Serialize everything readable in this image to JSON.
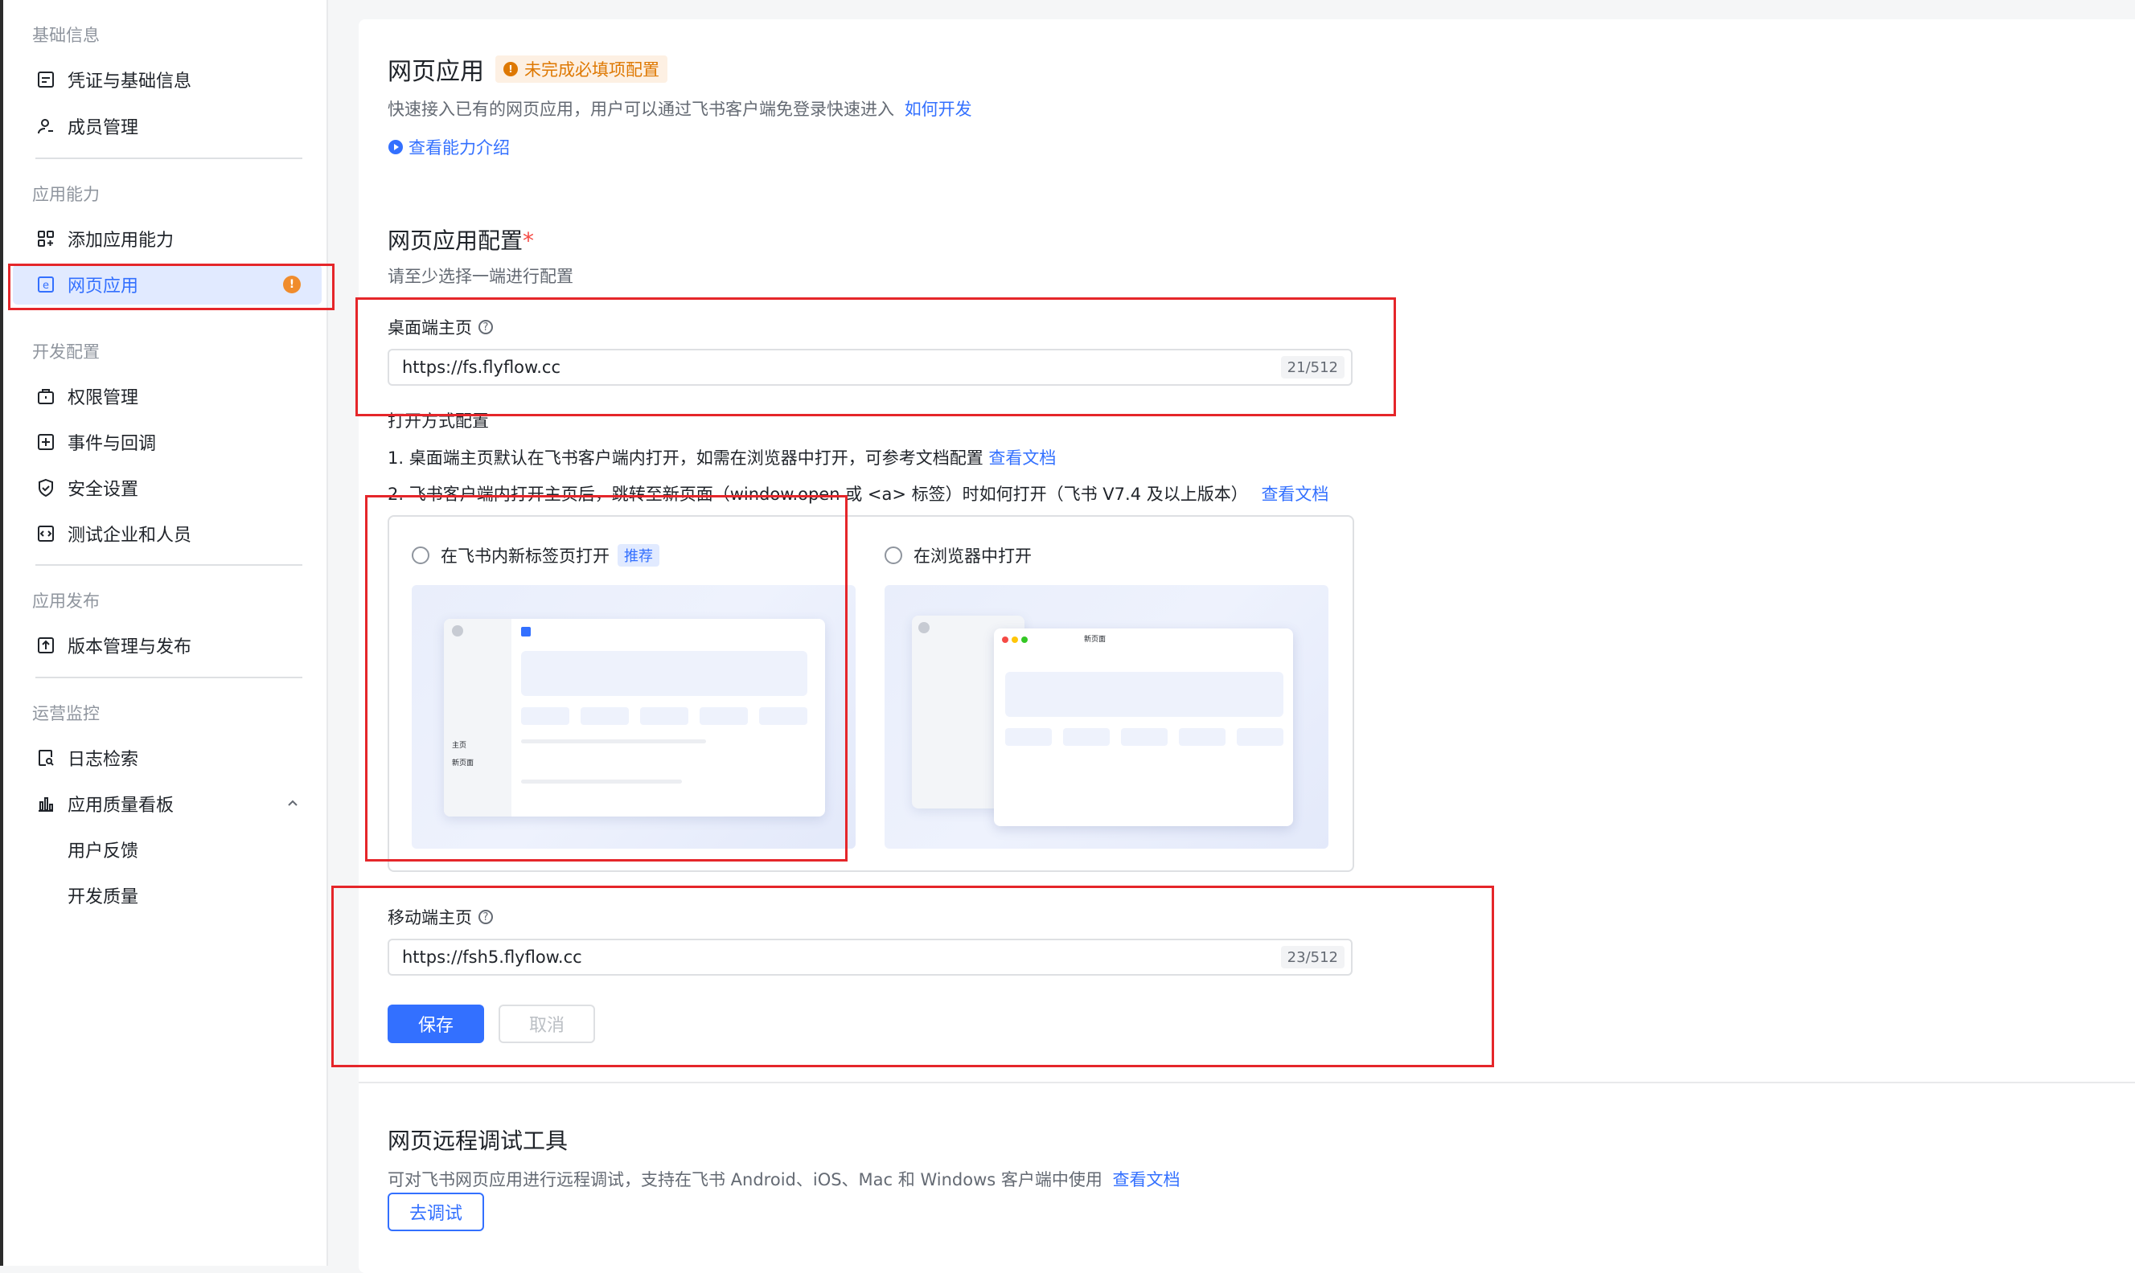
{
  "sidebar": {
    "groups": [
      {
        "title": "基础信息"
      },
      {
        "title": "应用能力"
      },
      {
        "title": "开发配置"
      },
      {
        "title": "应用发布"
      },
      {
        "title": "运营监控"
      }
    ],
    "items": {
      "credentials": "凭证与基础信息",
      "members": "成员管理",
      "add_capability": "添加应用能力",
      "web_app": "网页应用",
      "permissions": "权限管理",
      "events": "事件与回调",
      "security": "安全设置",
      "test_company": "测试企业和人员",
      "version": "版本管理与发布",
      "logs": "日志检索",
      "quality_board": "应用质量看板",
      "feedback": "用户反馈",
      "dev_quality": "开发质量"
    },
    "web_app_badge": "!"
  },
  "main": {
    "title": "网页应用",
    "status_badge": "未完成必填项配置",
    "status_badge_icon": "!",
    "description": "快速接入已有的网页应用，用户可以通过飞书客户端免登录快速进入",
    "how_to_link": "如何开发",
    "intro_link": "查看能力介绍",
    "config": {
      "title": "网页应用配置",
      "required_mark": "*",
      "hint": "请至少选择一端进行配置",
      "desktop_label": "桌面端主页",
      "desktop_url": "https://fs.flyflow.cc",
      "desktop_counter": "21/512",
      "open_mode_title": "打开方式配置",
      "note1": "1. 桌面端主页默认在飞书客户端内打开，如需在浏览器中打开，可参考文档配置",
      "note1_link": "查看文档",
      "note2": "2. 飞书客户端内打开主页后，跳转至新页面（window.open 或 <a> 标签）时如何打开（飞书 V7.4 及以上版本）",
      "note2_link": "查看文档",
      "option_tab": "在飞书内新标签页打开",
      "option_tab_tag": "推荐",
      "option_browser": "在浏览器中打开",
      "preview_home": "主页",
      "preview_new": "新页面",
      "mobile_label": "移动端主页",
      "mobile_url": "https://fsh5.flyflow.cc",
      "mobile_counter": "23/512",
      "save": "保存",
      "cancel": "取消"
    },
    "debug": {
      "title": "网页远程调试工具",
      "description": "可对飞书网页应用进行远程调试，支持在飞书 Android、iOS、Mac 和 Windows 客户端中使用",
      "doc_link": "查看文档",
      "button": "去调试"
    }
  },
  "colors": {
    "accent": "#3370ff",
    "warning": "#de7802",
    "annotation": "#e5262a"
  }
}
